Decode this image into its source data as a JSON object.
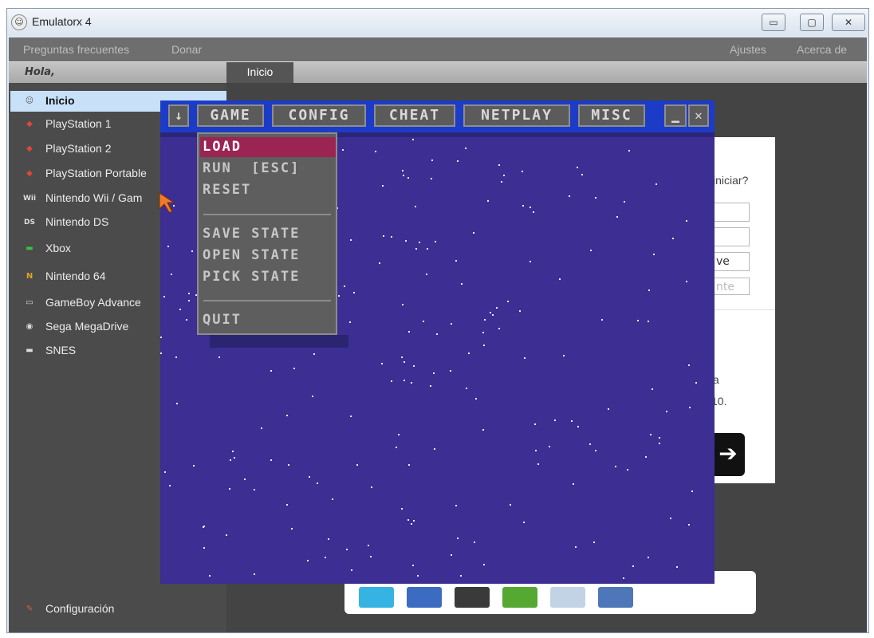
{
  "window": {
    "title": "Emulatorx 4",
    "controls": {
      "minimize": "▭",
      "maximize": "▢",
      "close": "✕"
    }
  },
  "menubar": {
    "left": [
      "Preguntas frecuentes",
      "Donar"
    ],
    "right": [
      "Ajustes",
      "Acerca de"
    ]
  },
  "greeting": "Hola,",
  "tabs": [
    {
      "label": "Inicio",
      "active": true
    }
  ],
  "sidebar": {
    "items": [
      {
        "label": "Inicio",
        "icon": "home-icon",
        "glyph": "☺",
        "active": true
      },
      {
        "label": "PlayStation 1",
        "icon": "playstation-icon",
        "glyph": "◆"
      },
      {
        "label": "PlayStation 2",
        "icon": "playstation-icon",
        "glyph": "◆"
      },
      {
        "label": "PlayStation Portable",
        "icon": "playstation-icon",
        "glyph": "◆"
      },
      {
        "label": "Nintendo Wii / Gam",
        "icon": "wii-icon",
        "glyph": "Wii"
      },
      {
        "label": "Nintendo DS",
        "icon": "ds-icon",
        "glyph": "DS"
      },
      {
        "label": "Xbox",
        "icon": "xbox-icon",
        "glyph": "▬"
      },
      {
        "label": "Nintendo 64",
        "icon": "n64-icon",
        "glyph": "N"
      },
      {
        "label": "GameBoy Advance",
        "icon": "gameboy-icon",
        "glyph": "▭"
      },
      {
        "label": "Sega MegaDrive",
        "icon": "gamepad-icon",
        "glyph": "◉"
      },
      {
        "label": "SNES",
        "icon": "snes-controller-icon",
        "glyph": "▬"
      }
    ],
    "footer": {
      "label": "Configuración",
      "icon": "wrench-icon",
      "glyph": "✎"
    }
  },
  "background_page": {
    "text_iniciar": "iniciar?",
    "input3_value": "ve",
    "input4_value": "nte",
    "text_a": "a",
    "text_10": "10.",
    "next_arrow": "➔"
  },
  "emulator": {
    "menu_glyph": "↓",
    "menu": [
      "GAME",
      "CONFIG",
      "CHEAT",
      "NETPLAY",
      "MISC"
    ],
    "minimize_glyph": "▁",
    "close_glyph": "✕",
    "dropdown": {
      "items": [
        "LOAD",
        "RUN  [ESC]",
        "RESET",
        "SAVE STATE",
        "OPEN STATE",
        "PICK STATE",
        "QUIT"
      ],
      "selected": "LOAD"
    }
  },
  "colors": {
    "emulator_bg": "#3c2e93",
    "emulator_bar": "#1c3cc7",
    "dropdown_selected": "#9b2453",
    "sidebar_bg": "#4b4b4b",
    "sidebar_active": "#c8e1f8"
  }
}
